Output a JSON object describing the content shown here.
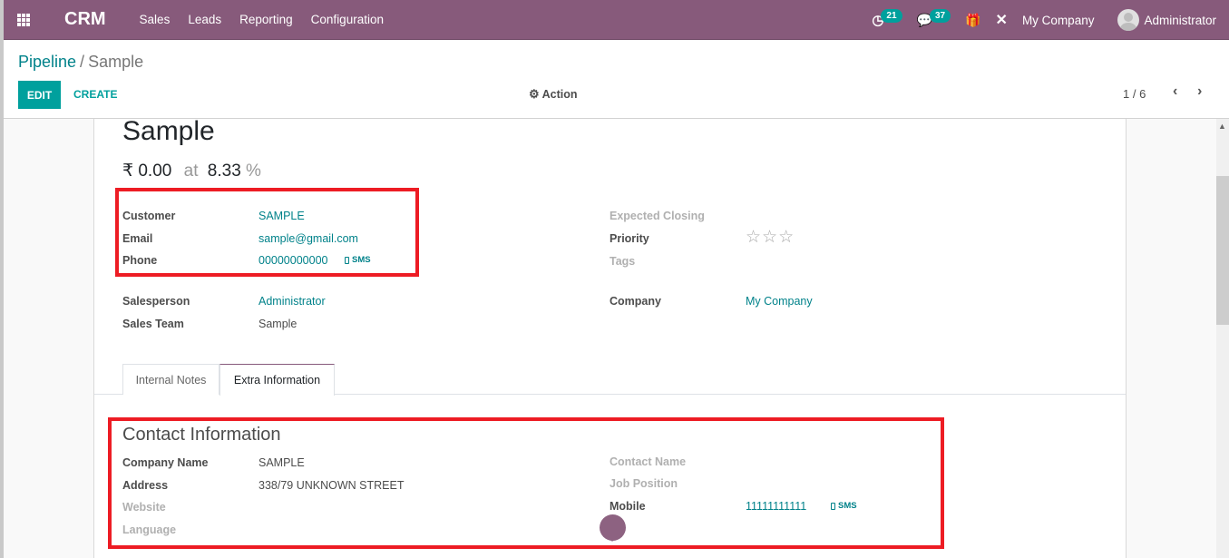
{
  "navbar": {
    "brand": "CRM",
    "menu": [
      "Sales",
      "Leads",
      "Reporting",
      "Configuration"
    ],
    "activity_count": "21",
    "message_count": "37",
    "company": "My Company",
    "user": "Administrator"
  },
  "control": {
    "breadcrumb_parent": "Pipeline",
    "breadcrumb_sep": "/",
    "breadcrumb_current": "Sample",
    "edit_label": "EDIT",
    "create_label": "CREATE",
    "action_label": "Action",
    "pager": "1 / 6"
  },
  "record": {
    "title": "Sample",
    "revenue": "₹ 0.00",
    "at_label": "at",
    "probability": "8.33",
    "percent_sign": "%",
    "customer_label": "Customer",
    "customer": "SAMPLE",
    "email_label": "Email",
    "email": "sample@gmail.com",
    "phone_label": "Phone",
    "phone": "00000000000",
    "sms_label": "SMS",
    "salesperson_label": "Salesperson",
    "salesperson": "Administrator",
    "sales_team_label": "Sales Team",
    "sales_team": "Sample",
    "expected_closing_label": "Expected Closing",
    "priority_label": "Priority",
    "priority_stars": 0,
    "priority_max": 3,
    "tags_label": "Tags",
    "company_label": "Company",
    "company": "My Company"
  },
  "tabs": [
    {
      "label": "Internal Notes",
      "active": false
    },
    {
      "label": "Extra Information",
      "active": true
    }
  ],
  "contact": {
    "title": "Contact Information",
    "company_name_label": "Company Name",
    "company_name": "SAMPLE",
    "address_label": "Address",
    "address": "338/79 UNKNOWN STREET",
    "website_label": "Website",
    "language_label": "Language",
    "contact_name_label": "Contact Name",
    "job_position_label": "Job Position",
    "mobile_label": "Mobile",
    "mobile": "11111111111",
    "sms_label": "SMS"
  },
  "colors": {
    "brand": "#875a7b",
    "accent": "#00a09d",
    "link": "#00828a",
    "highlight": "#ed1c24"
  }
}
